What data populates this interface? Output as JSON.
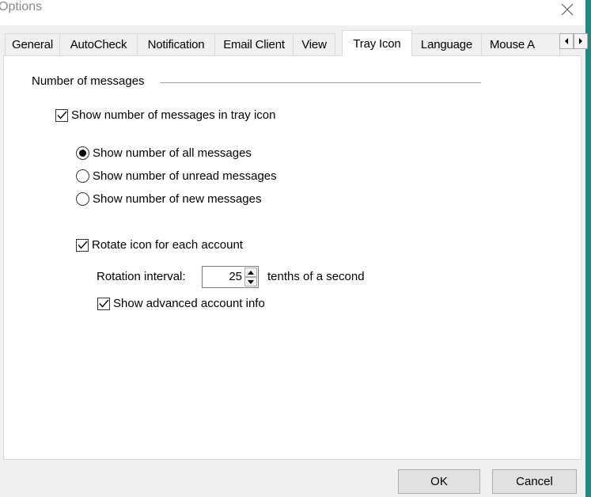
{
  "window": {
    "title": "Options"
  },
  "tabs": [
    {
      "label": "General"
    },
    {
      "label": "AutoCheck"
    },
    {
      "label": "Notification"
    },
    {
      "label": "Email Client"
    },
    {
      "label": "View"
    },
    {
      "label": "Tray Icon"
    },
    {
      "label": "Language"
    },
    {
      "label": "Mouse A"
    }
  ],
  "active_tab": "Tray Icon",
  "group": {
    "label": "Number of messages"
  },
  "options": {
    "show_count": {
      "label": "Show number of messages in tray icon",
      "checked": true
    },
    "radio_all": {
      "label": "Show number of all messages",
      "selected": true
    },
    "radio_unread": {
      "label": "Show number of unread messages",
      "selected": false
    },
    "radio_new": {
      "label": "Show number of new messages",
      "selected": false
    },
    "rotate": {
      "label": "Rotate icon for each account",
      "checked": true
    },
    "rotation_interval_label": "Rotation interval:",
    "rotation_interval_value": "25",
    "rotation_interval_unit": "tenths of a second",
    "advanced_info": {
      "label": "Show advanced account info",
      "checked": true
    }
  },
  "buttons": {
    "ok": "OK",
    "cancel": "Cancel"
  },
  "icons": {
    "close": "close-icon",
    "check": "check-icon",
    "scroll_left": "scroll-left-icon",
    "scroll_right": "scroll-right-icon",
    "spin_up": "spin-up-icon",
    "spin_down": "spin-down-icon"
  }
}
